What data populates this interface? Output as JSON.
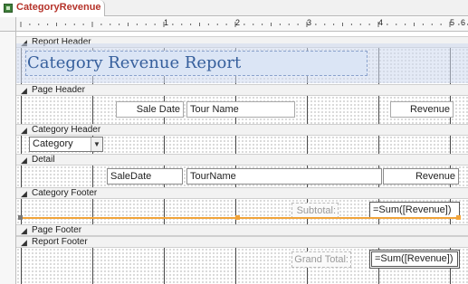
{
  "document_tab": {
    "title": "CategoryRevenue"
  },
  "ruler": {
    "marks": [
      "1",
      "2",
      "3",
      "4",
      "5",
      "6"
    ]
  },
  "sections": {
    "report_header": "Report Header",
    "page_header": "Page Header",
    "category_header": "Category Header",
    "detail": "Detail",
    "category_footer": "Category Footer",
    "page_footer": "Page Footer",
    "report_footer": "Report Footer"
  },
  "report_title": "Category Revenue Report",
  "page_header_labels": {
    "sale_date": "Sale Date",
    "tour_name": "Tour Name",
    "revenue": "Revenue"
  },
  "category_combo": {
    "value": "Category",
    "arrow": "▼"
  },
  "detail_fields": {
    "sale_date": "SaleDate",
    "tour_name": "TourName",
    "revenue": "Revenue"
  },
  "category_footer": {
    "label": "Subtotal:",
    "expression": "=Sum([Revenue])"
  },
  "report_footer": {
    "label": "Grand Total:",
    "expression": "=Sum([Revenue])"
  }
}
